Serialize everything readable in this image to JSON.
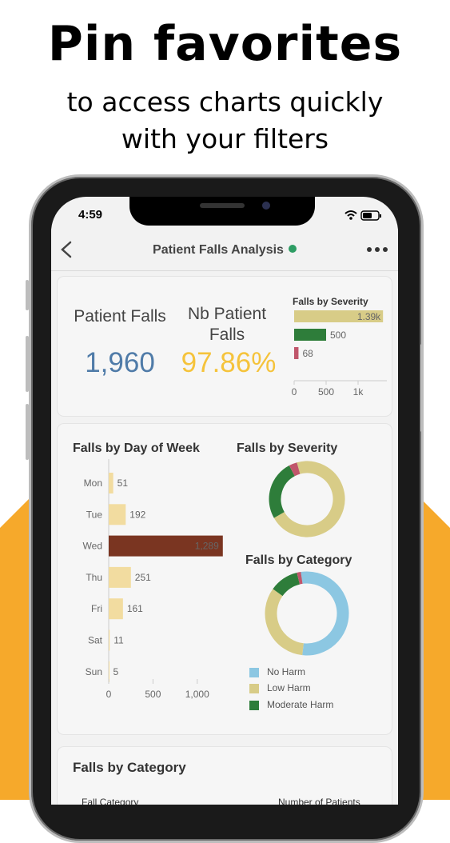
{
  "promo": {
    "title": "Pin favorites",
    "subtitle_line1": "to access charts quickly",
    "subtitle_line2": "with your filters"
  },
  "status_bar": {
    "time": "4:59"
  },
  "header": {
    "title": "Patient Falls Analysis",
    "back_icon": "chevron-left-icon",
    "more_icon": "more-horizontal-icon"
  },
  "kpis": {
    "patient_falls": {
      "label": "Patient Falls",
      "value": "1,960",
      "color": "#4f7ba8"
    },
    "nb_patient_falls": {
      "label_line1": "Nb Patient",
      "label_line2": "Falls",
      "value": "97.86%",
      "color": "#f5c33b"
    }
  },
  "chart_data": [
    {
      "id": "mini_severity",
      "type": "bar",
      "orientation": "horizontal",
      "title": "Falls by Severity",
      "categories": [
        "",
        "",
        ""
      ],
      "values": [
        1390,
        500,
        68
      ],
      "data_labels": [
        "1.39k",
        "500",
        "68"
      ],
      "colors": [
        "#d8cc87",
        "#2e7d3a",
        "#c0566b"
      ],
      "x_ticks": [
        "0",
        "500",
        "1k"
      ],
      "xlim": [
        0,
        1450
      ]
    },
    {
      "id": "day_of_week",
      "type": "bar",
      "orientation": "horizontal",
      "title": "Falls by Day of Week",
      "categories": [
        "Mon",
        "Tue",
        "Wed",
        "Thu",
        "Fri",
        "Sat",
        "Sun"
      ],
      "values": [
        51,
        192,
        1289,
        251,
        161,
        11,
        5
      ],
      "data_labels": [
        "51",
        "192",
        "1,289",
        "251",
        "161",
        "11",
        "5"
      ],
      "colors": [
        "#f2dca0",
        "#f2dca0",
        "#7a3521",
        "#f2dca0",
        "#f2dca0",
        "#f2dca0",
        "#f2dca0"
      ],
      "x_ticks": [
        "0",
        "500",
        "1,000"
      ],
      "xlim": [
        0,
        1300
      ]
    },
    {
      "id": "severity_donut",
      "type": "pie",
      "style": "donut",
      "title": "Falls by Severity",
      "categories": [
        "",
        "",
        ""
      ],
      "values": [
        1390,
        500,
        68
      ],
      "colors": [
        "#d8cc87",
        "#2e7d3a",
        "#c0566b"
      ]
    },
    {
      "id": "category_donut",
      "type": "pie",
      "style": "donut",
      "title": "Falls by Category",
      "categories": [
        "No Harm",
        "Low Harm",
        "Moderate Harm",
        ""
      ],
      "values": [
        1060,
        650,
        220,
        30
      ],
      "colors": [
        "#8cc7e2",
        "#d8cc87",
        "#2e7d3a",
        "#c0566b"
      ],
      "legend": [
        "No Harm",
        "Low Harm",
        "Moderate Harm"
      ],
      "legend_position": "bottom"
    }
  ],
  "table_card": {
    "title": "Falls by Category",
    "col1": "Fall Category",
    "col2": "Number of Patients"
  }
}
